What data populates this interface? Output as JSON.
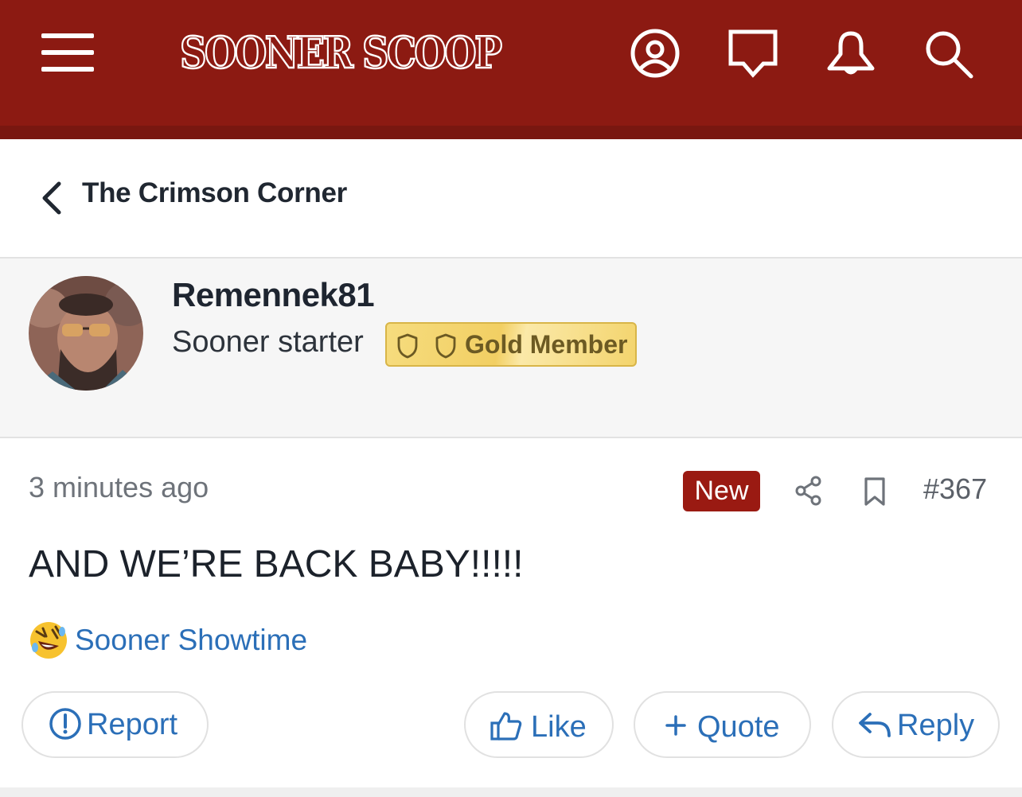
{
  "header": {
    "logo_text": "SOONER SCOOP",
    "icons": [
      "menu-icon",
      "profile-icon",
      "chat-icon",
      "notification-bell-icon",
      "search-icon"
    ],
    "brand_color": "#8c1a12"
  },
  "breadcrumb": {
    "title": "The Crimson Corner"
  },
  "author": {
    "username": "Remennek81",
    "title": "Sooner starter",
    "badge_label": "Gold Member"
  },
  "post": {
    "time": "3 minutes ago",
    "new_label": "New",
    "number": "#367",
    "body": "AND WE’RE BACK BABY!!!!!",
    "reaction_user": "Sooner Showtime",
    "reaction_icon": "laughing-emoji-icon"
  },
  "actions": {
    "report": "Report",
    "like": "Like",
    "quote": "Quote",
    "reply": "Reply"
  },
  "colors": {
    "link": "#2b6fb8",
    "new_badge": "#9a1a12",
    "gold_badge": "#f2cf63"
  }
}
